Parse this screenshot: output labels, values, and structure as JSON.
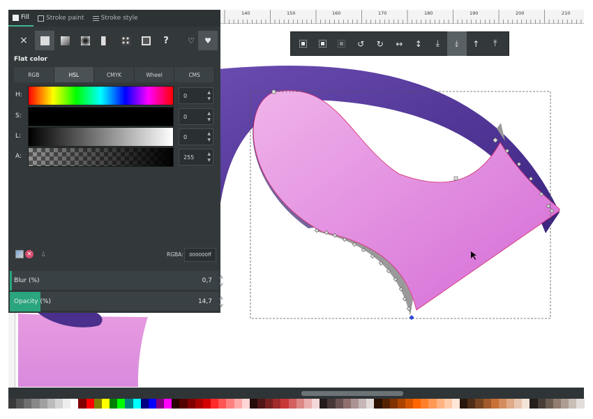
{
  "tabs": [
    {
      "label": "Fill",
      "icon": "fill-square-icon"
    },
    {
      "label": "Stroke paint",
      "icon": "stroke-square-icon"
    },
    {
      "label": "Stroke style",
      "icon": "stroke-style-icon"
    }
  ],
  "paint_types": {
    "no_paint": "×",
    "unset": "?",
    "icons": [
      "no-paint-icon",
      "flat-color-icon",
      "linear-gradient-icon",
      "radial-gradient-icon",
      "mesh-gradient-icon",
      "pattern-icon",
      "swatch-icon",
      "unset-paint-icon",
      "fill-rule-evenodd-icon",
      "fill-rule-nonzero-icon"
    ]
  },
  "flat_color_title": "Flat color",
  "color_modes": [
    "RGB",
    "HSL",
    "CMYK",
    "Wheel",
    "CMS"
  ],
  "active_mode": "HSL",
  "sliders": [
    {
      "label": "H:",
      "value": "0"
    },
    {
      "label": "S:",
      "value": "0"
    },
    {
      "label": "L:",
      "value": "0"
    },
    {
      "label": "A:",
      "value": "255"
    }
  ],
  "rgba": {
    "label": "RGBA:",
    "value": "000000ff"
  },
  "blur": {
    "label": "Blur (%)",
    "value": "0,7",
    "fill": 0.007
  },
  "opacity": {
    "label": "Opacity (%)",
    "value": "14,7",
    "fill": 0.147
  },
  "ruler_top_labels": [
    "140",
    "150",
    "160",
    "170",
    "180",
    "190",
    "200",
    "210"
  ],
  "toolbar_icons": [
    "select-all-icon",
    "select-all-layers-icon",
    "deselect-icon",
    "rotate-ccw-icon",
    "rotate-cw-icon",
    "flip-horizontal-icon",
    "flip-vertical-icon",
    "lower-to-bottom-icon",
    "lower-icon",
    "raise-icon",
    "raise-to-top-icon"
  ],
  "toolbar_glyphs": [
    "",
    "",
    "",
    "↺",
    "↻",
    "↔",
    "↕",
    "⤓",
    "⤈",
    "↑",
    "⤒"
  ],
  "palette": [
    "#3a3a3a",
    "#555555",
    "#6e6e6e",
    "#888888",
    "#a0a0a0",
    "#bbbbbb",
    "#d4d4d4",
    "#eeeeee",
    "#ffffff",
    "#800000",
    "#ff0000",
    "#808000",
    "#ffff00",
    "#008000",
    "#00ff00",
    "#008080",
    "#00ffff",
    "#000080",
    "#0000ff",
    "#800080",
    "#ff00ff",
    "#2b0000",
    "#550000",
    "#800000",
    "#aa0000",
    "#d40000",
    "#ff2a2a",
    "#ff5555",
    "#ff8080",
    "#ffaaaa",
    "#ffd5d5",
    "#280b0b",
    "#501616",
    "#782121",
    "#a02c2c",
    "#c83737",
    "#d35f5f",
    "#de8787",
    "#e9afaf",
    "#f4d7d7",
    "#241c1c",
    "#483737",
    "#6c5353",
    "#916f6f",
    "#ac9393",
    "#c8b7b7",
    "#e3dbdb",
    "#2b1100",
    "#552200",
    "#803300",
    "#aa4400",
    "#d45500",
    "#ff6600",
    "#ff7f2a",
    "#ff9955",
    "#ffb380",
    "#ffccaa",
    "#ffe6d5",
    "#28170b",
    "#502d16",
    "#784421",
    "#a05a2c",
    "#c87137",
    "#d38d5f",
    "#deaa87",
    "#e9c6af",
    "#f4e3d7",
    "#241f1c",
    "#483e37",
    "#6c5d53",
    "#917c6f",
    "#ac9d93",
    "#c8beb7",
    "#e3dedb"
  ]
}
